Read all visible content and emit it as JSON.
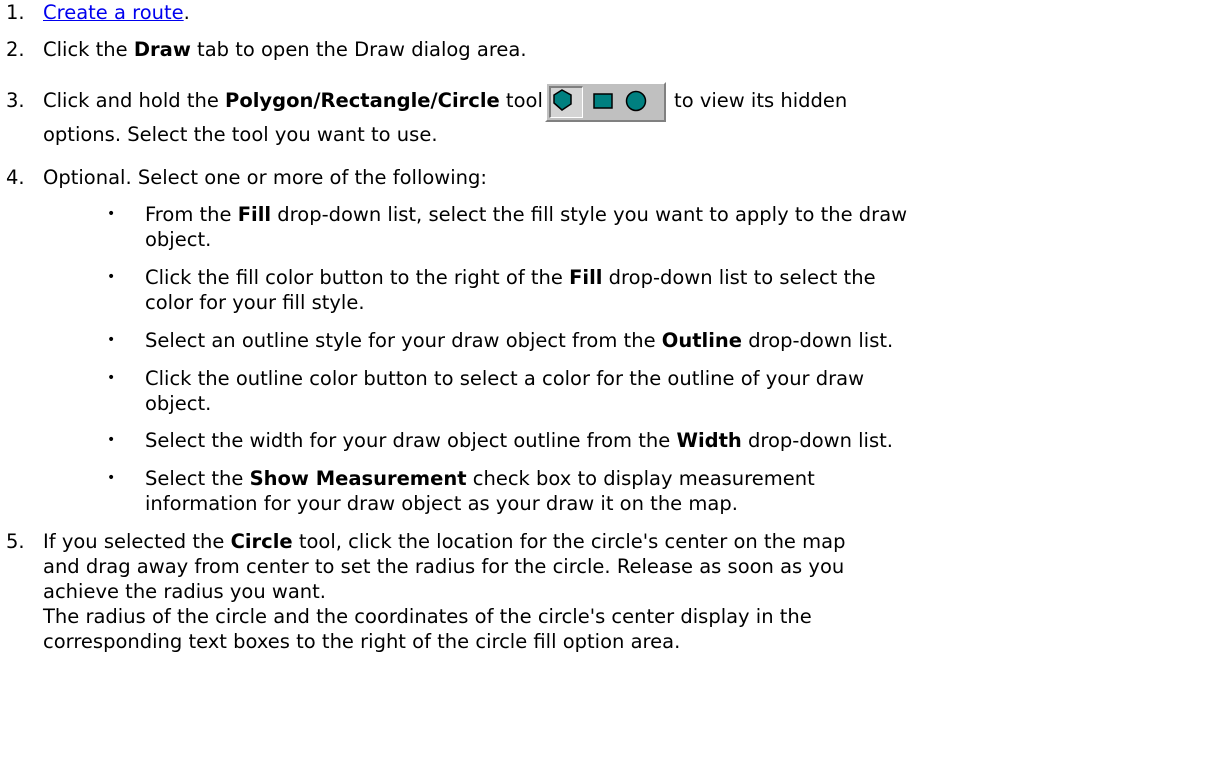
{
  "steps": [
    {
      "num": "1.",
      "link": "Create a route",
      "after": "."
    },
    {
      "num": "2.",
      "pre": "Click the ",
      "bold": "Draw",
      "post": " tab to open the Draw dialog area."
    },
    {
      "num": "3.",
      "pre": "Click and hold the ",
      "bold": "Polygon/Rectangle/Circle",
      "post1": " tool",
      "post2": " to view its hidden",
      "line2": "options. Select the tool you want to use."
    },
    {
      "num": "4.",
      "text": "Optional. Select one or more of the following:"
    },
    {
      "num": "5.",
      "pre": "If you selected the ",
      "bold": "Circle",
      "post": " tool, click the location for the circle's center on the map",
      "line2": "and drag away from center to set the radius for the circle. Release as soon as you",
      "line3": "achieve the radius you want.",
      "line4": "The radius of the circle and the coordinates of the circle's center display in the",
      "line5": "corresponding text boxes to the right of the circle fill option area."
    }
  ],
  "bullets": [
    {
      "pre": "From the ",
      "bold": "Fill",
      "post": " drop-down list, select the fill style you want to apply to the draw",
      "line2": "object."
    },
    {
      "pre": "Click the fill color button to the right of the ",
      "bold": "Fill",
      "post": " drop-down list to select the",
      "line2": "color for your fill style."
    },
    {
      "pre": "Select an outline style for your draw object from the ",
      "bold": "Outline",
      "post": " drop-down list."
    },
    {
      "pre": "Click the outline color button to select a color for the outline of your draw",
      "line2": "object."
    },
    {
      "pre": "Select the width for your draw object outline from the ",
      "bold": "Width",
      "post": " drop-down list."
    },
    {
      "pre": "Select the ",
      "bold": "Show Measurement",
      "post": " check box to display measurement",
      "line2": "information for your draw object as your draw it on the map."
    }
  ],
  "bullet_glyph": "•",
  "toolbar": {
    "icons": [
      "polygon-tool-icon",
      "rectangle-tool-icon",
      "circle-tool-icon"
    ],
    "fill_color": "#008080",
    "face_color": "#c0c0c0"
  },
  "link_color": "#0000ee"
}
